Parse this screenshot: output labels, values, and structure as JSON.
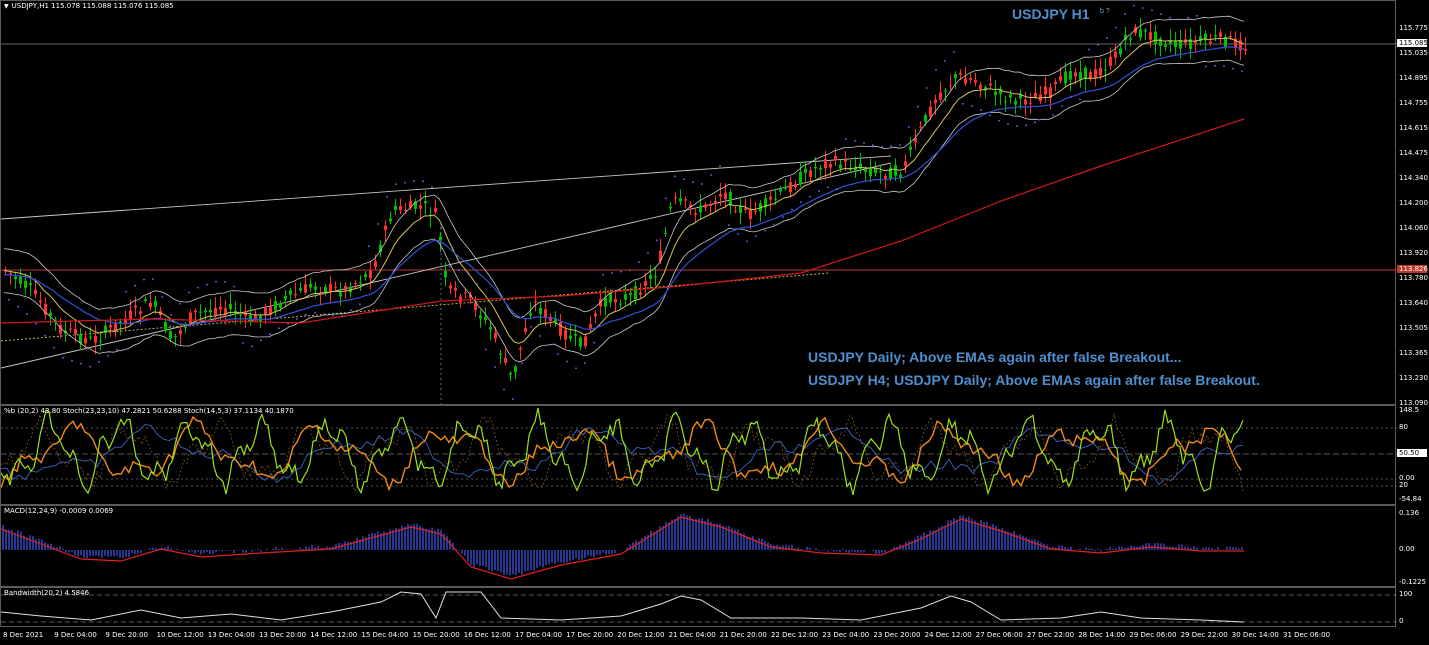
{
  "main": {
    "label": "USDJPY,H1  115.078 115.088 115.076 115.085",
    "title": "USDJPY H1",
    "title_sub": "b ?",
    "annotation_1": "USDJPY Daily; Above EMAs again after false Breakout...",
    "annotation_2": "USDJPY H4; USDJPY Daily; Above EMAs again after false Breakout.",
    "price_ticks": [
      "115.775",
      "115.035",
      "114.895",
      "114.755",
      "114.615",
      "114.475",
      "114.340",
      "114.200",
      "114.060",
      "113.920",
      "113.780",
      "113.640",
      "113.505",
      "113.365",
      "113.230",
      "113.090"
    ],
    "current_price": "115.085",
    "level_price": "113.826"
  },
  "oscillator": {
    "label": "%b (20,2) 43.80  Stoch(23,23,10) 47.2821 50.6288  Stoch(14,5,3) 37.1134 40.1870",
    "ticks": [
      "148.5",
      "80",
      "50.50",
      "0.00",
      "20",
      "-54.84"
    ],
    "current": "50.50"
  },
  "macd": {
    "label": "MACD(12,24,9) -0.0009 0.0069",
    "ticks": [
      "0.136",
      "0.00",
      "-0.1225"
    ]
  },
  "bandwidth": {
    "label": "Bandwidth(20,2) 4.5846",
    "ticks": [
      "100",
      "0"
    ]
  },
  "time_axis": [
    "8 Dec 2021",
    "9 Dec 04:00",
    "9 Dec 20:00",
    "10 Dec 12:00",
    "13 Dec 04:00",
    "13 Dec 20:00",
    "14 Dec 12:00",
    "15 Dec 04:00",
    "15 Dec 20:00",
    "16 Dec 12:00",
    "17 Dec 04:00",
    "17 Dec 20:00",
    "20 Dec 12:00",
    "21 Dec 04:00",
    "21 Dec 20:00",
    "22 Dec 12:00",
    "23 Dec 04:00",
    "23 Dec 20:00",
    "24 Dec 12:00",
    "27 Dec 06:00",
    "27 Dec 22:00",
    "28 Dec 14:00",
    "29 Dec 06:00",
    "29 Dec 22:00",
    "30 Dec 14:00",
    "31 Dec 06:00"
  ],
  "colors": {
    "background": "#000000",
    "bull_candle": "#00c000",
    "bear_candle": "#ff3030",
    "ema_fast": "#d6c25a",
    "ema_mid": "#2f52d8",
    "ema_slow": "#d01818",
    "bollinger": "#c8c8c8",
    "annotation": "#4f8fcf",
    "stoch_fast": "#9be21a",
    "stoch_slow": "#f08a1a",
    "macd_hist": "#3a4fd0",
    "macd_signal": "#e02020"
  }
}
